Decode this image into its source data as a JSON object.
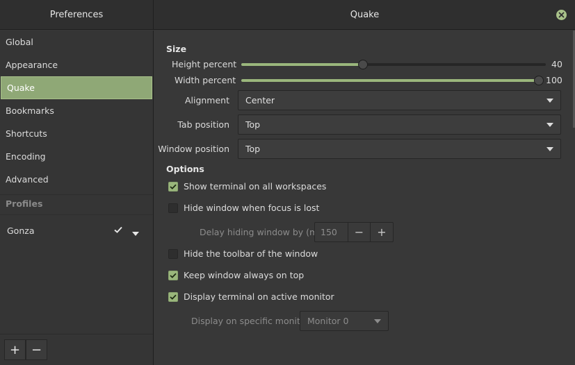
{
  "header": {
    "left_title": "Preferences",
    "right_title": "Quake"
  },
  "sidebar": {
    "items": [
      {
        "label": "Global"
      },
      {
        "label": "Appearance"
      },
      {
        "label": "Quake"
      },
      {
        "label": "Bookmarks"
      },
      {
        "label": "Shortcuts"
      },
      {
        "label": "Encoding"
      },
      {
        "label": "Advanced"
      }
    ],
    "selected": "Quake",
    "profiles_heading": "Profiles",
    "profiles": [
      {
        "name": "Gonza",
        "default": true
      }
    ],
    "add_label": "+",
    "remove_label": "−"
  },
  "size": {
    "heading": "Size",
    "height_label": "Height percent",
    "height_value": "40",
    "height_fraction": 0.4,
    "width_label": "Width percent",
    "width_value": "100",
    "width_fraction": 1.0,
    "alignment_label": "Alignment",
    "alignment_value": "Center",
    "tab_position_label": "Tab position",
    "tab_position_value": "Top",
    "window_position_label": "Window position",
    "window_position_value": "Top"
  },
  "options": {
    "heading": "Options",
    "show_all_workspaces": {
      "label": "Show terminal on all workspaces",
      "checked": true
    },
    "hide_on_focus_lost": {
      "label": "Hide window when focus is lost",
      "checked": false
    },
    "delay_label": "Delay hiding window by (ms)",
    "delay_value": "150",
    "hide_toolbar": {
      "label": "Hide the toolbar of the window",
      "checked": false
    },
    "always_on_top": {
      "label": "Keep window always on top",
      "checked": true
    },
    "active_monitor": {
      "label": "Display terminal on active monitor",
      "checked": true
    },
    "specific_monitor_label": "Display on specific monitor",
    "specific_monitor_value": "Monitor 0"
  },
  "colors": {
    "accent": "#9ab67c",
    "selected_bg": "#8fa876",
    "background": "#383838",
    "sidebar_bg": "#353535"
  },
  "icons": {
    "close": "close-icon",
    "checkmark": "checkmark-icon",
    "dropdown": "chevron-down-icon"
  }
}
